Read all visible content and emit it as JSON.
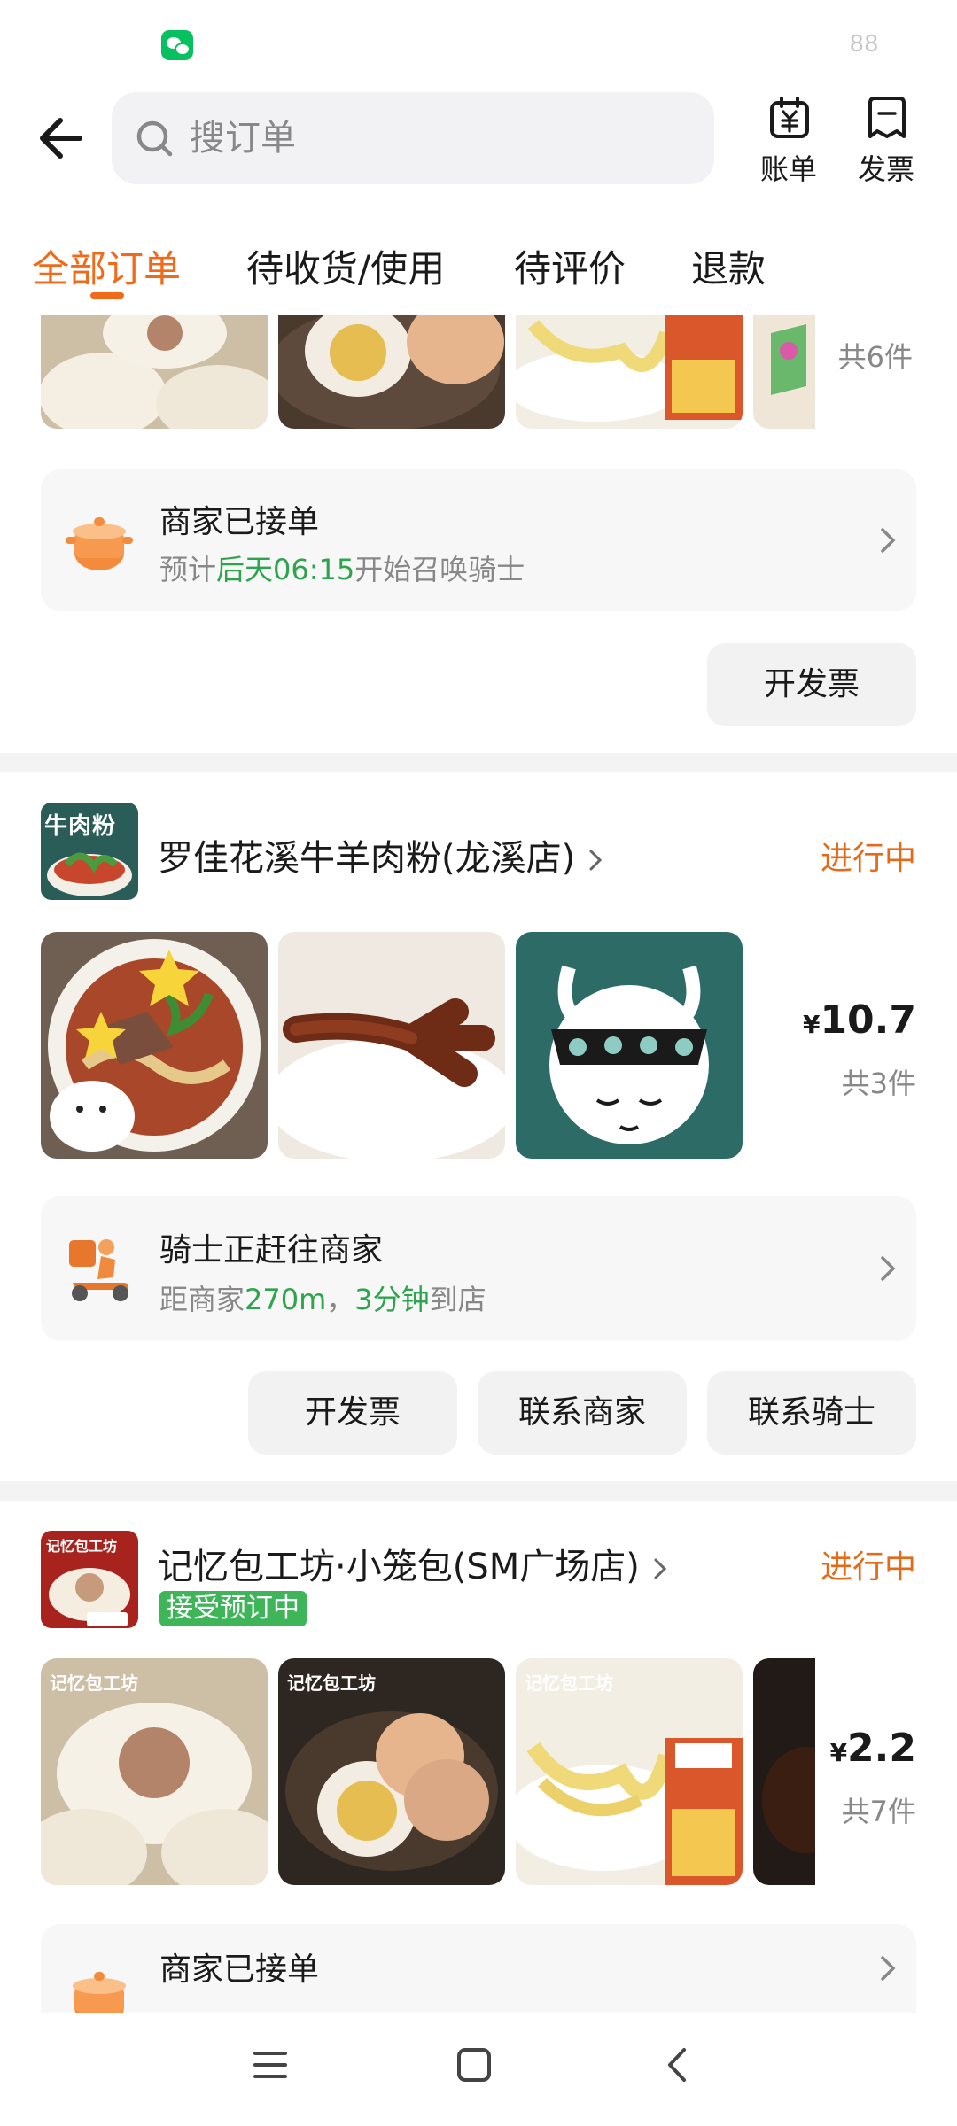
{
  "status_bar": {
    "battery": "88",
    "app_icon": "wechat-icon"
  },
  "header": {
    "back_icon": "arrow-left-icon",
    "search_placeholder": "搜订单",
    "bill_label": "账单",
    "invoice_label": "发票"
  },
  "tabs": [
    {
      "label": "全部订单",
      "active": true
    },
    {
      "label": "待收货/使用",
      "active": false
    },
    {
      "label": "待评价",
      "active": false
    },
    {
      "label": "退款",
      "active": false
    }
  ],
  "order1": {
    "item_count": "共6件",
    "status_title": "商家已接单",
    "status_pre": "预计",
    "status_highlight": "后天06:15",
    "status_post": "开始召唤骑士",
    "invoice_btn": "开发票"
  },
  "order2": {
    "store_logo_text": "牛肉粉",
    "store_name": "罗佳花溪牛羊肉粉(龙溪店)",
    "order_status": "进行中",
    "currency": "¥",
    "price": "10.7",
    "item_count": "共3件",
    "status_title": "骑士正赶往商家",
    "status_pre": "距商家",
    "status_dist": "270m",
    "status_sep": "，",
    "status_time": "3分钟",
    "status_post": "到店",
    "buttons": [
      "开发票",
      "联系商家",
      "联系骑士"
    ]
  },
  "order3": {
    "store_logo_text": "记忆包工坊",
    "store_name": "记忆包工坊·小笼包(SM广场店)",
    "badge": "接受预订中",
    "order_status": "进行中",
    "currency": "¥",
    "price": "2.2",
    "item_count": "共7件",
    "tile_brand": "记忆包工坊",
    "status_title": "商家已接单"
  },
  "colors": {
    "accent": "#f06a1a",
    "green": "#2ea44f",
    "badge_green": "#3fb55a"
  }
}
